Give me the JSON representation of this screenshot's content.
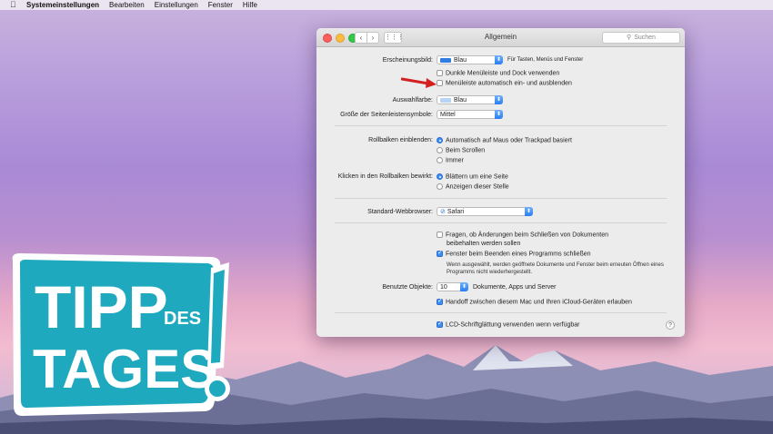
{
  "menubar": {
    "app": "Systemeinstellungen",
    "items": [
      "Bearbeiten",
      "Einstellungen",
      "Fenster",
      "Hilfe"
    ]
  },
  "window": {
    "title": "Allgemein",
    "search_placeholder": "Suchen",
    "appearance": {
      "label": "Erscheinungsbild:",
      "value": "Blau",
      "note": "Für Tasten, Menüs und Fenster",
      "dark_menu": {
        "label": "Dunkle Menüleiste und Dock verwenden",
        "checked": false
      },
      "auto_hide": {
        "label": "Menüleiste automatisch ein- und ausblenden",
        "checked": false
      }
    },
    "highlight": {
      "label": "Auswahlfarbe:",
      "value": "Blau"
    },
    "sidebar_icon": {
      "label": "Größe der Seitenleistensymbole:",
      "value": "Mittel"
    },
    "scrollbars": {
      "label": "Rollbalken einblenden:",
      "options": [
        "Automatisch auf Maus oder Trackpad basiert",
        "Beim Scrollen",
        "Immer"
      ],
      "selected": 0
    },
    "click_scroll": {
      "label": "Klicken in den Rollbalken bewirkt:",
      "options": [
        "Blättern um eine Seite",
        "Anzeigen dieser Stelle"
      ],
      "selected": 0
    },
    "browser": {
      "label": "Standard-Webbrowser:",
      "value": "Safari"
    },
    "ask_changes": {
      "label_line1": "Fragen, ob Änderungen beim Schließen von Dokumenten",
      "label_line2": "beibehalten werden sollen",
      "checked": false
    },
    "close_windows": {
      "label": "Fenster beim Beenden eines Programms schließen",
      "checked": true
    },
    "close_note_line1": "Wenn ausgewählt, werden geöffnete Dokumente und Fenster beim erneuten Öffnen eines",
    "close_note_line2": "Programms nicht wiederhergestellt.",
    "recent": {
      "label": "Benutzte Objekte:",
      "value": "10",
      "suffix": "Dokumente, Apps und Server"
    },
    "handoff": {
      "label": "Handoff zwischen diesem Mac und Ihren iCloud-Geräten erlauben",
      "checked": true
    },
    "lcd": {
      "label": "LCD-Schriftglättung verwenden wenn verfügbar",
      "checked": true
    },
    "help": "?"
  },
  "badge": {
    "line1": "TIPP",
    "small": "DES",
    "line2": "TAGES",
    "color": "#1fa9be"
  },
  "colors": {
    "accent_blue": "#3b8ef5",
    "arrow_red": "#d42020"
  }
}
